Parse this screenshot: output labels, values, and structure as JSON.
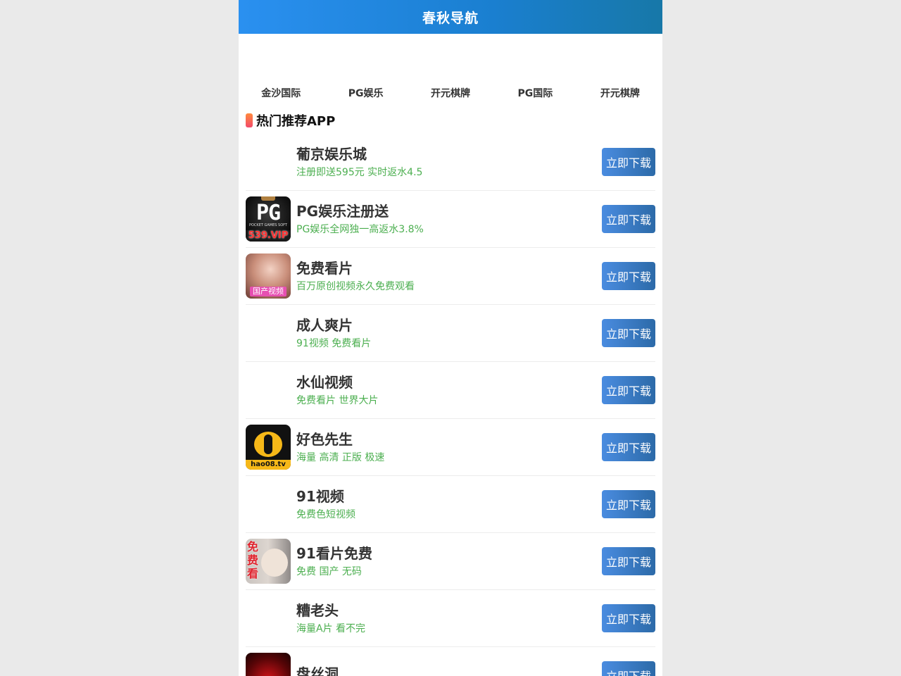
{
  "header": {
    "title": "春秋导航"
  },
  "nav": {
    "items": [
      {
        "label": "金沙国际"
      },
      {
        "label": "PG娱乐"
      },
      {
        "label": "开元棋牌"
      },
      {
        "label": "PG国际"
      },
      {
        "label": "开元棋牌"
      }
    ]
  },
  "section": {
    "title": "热门推荐APP"
  },
  "apps": [
    {
      "name": "葡京娱乐城",
      "desc": "注册即送595元 实时返水4.5",
      "button": "立即下载",
      "icon": "blank"
    },
    {
      "name": "PG娱乐注册送",
      "desc": "PG娱乐全网独一高返水3.8%",
      "button": "立即下载",
      "icon": "pg-logo-icon",
      "icon_text": {
        "letters": "PG",
        "sub": "POCKET GAMES SOFT",
        "vip": "539.VIP"
      }
    },
    {
      "name": "免费看片",
      "desc": "百万原创视频永久免费观看",
      "button": "立即下载",
      "icon": "photo-icon",
      "icon_text": {
        "tag": "国产视频"
      }
    },
    {
      "name": "成人爽片",
      "desc": "91视频 免费看片",
      "button": "立即下载",
      "icon": "blank"
    },
    {
      "name": "水仙视频",
      "desc": "免费看片 世界大片",
      "button": "立即下载",
      "icon": "blank"
    },
    {
      "name": "好色先生",
      "desc": "海量 高清 正版 极速",
      "button": "立即下载",
      "icon": "hao-logo-icon",
      "icon_text": {
        "tag": "hao08.tv"
      }
    },
    {
      "name": "91视频",
      "desc": "免费色短视频",
      "button": "立即下载",
      "icon": "blank"
    },
    {
      "name": "91看片免费",
      "desc": "免费 国产 无码",
      "button": "立即下载",
      "icon": "mianfei-icon",
      "icon_text": {
        "tag": "免费看"
      }
    },
    {
      "name": "糟老头",
      "desc": "海量A片 看不完",
      "button": "立即下载",
      "icon": "blank"
    },
    {
      "name": "盘丝洞",
      "desc": "",
      "button": "立即下载",
      "icon": "red-icon"
    }
  ]
}
